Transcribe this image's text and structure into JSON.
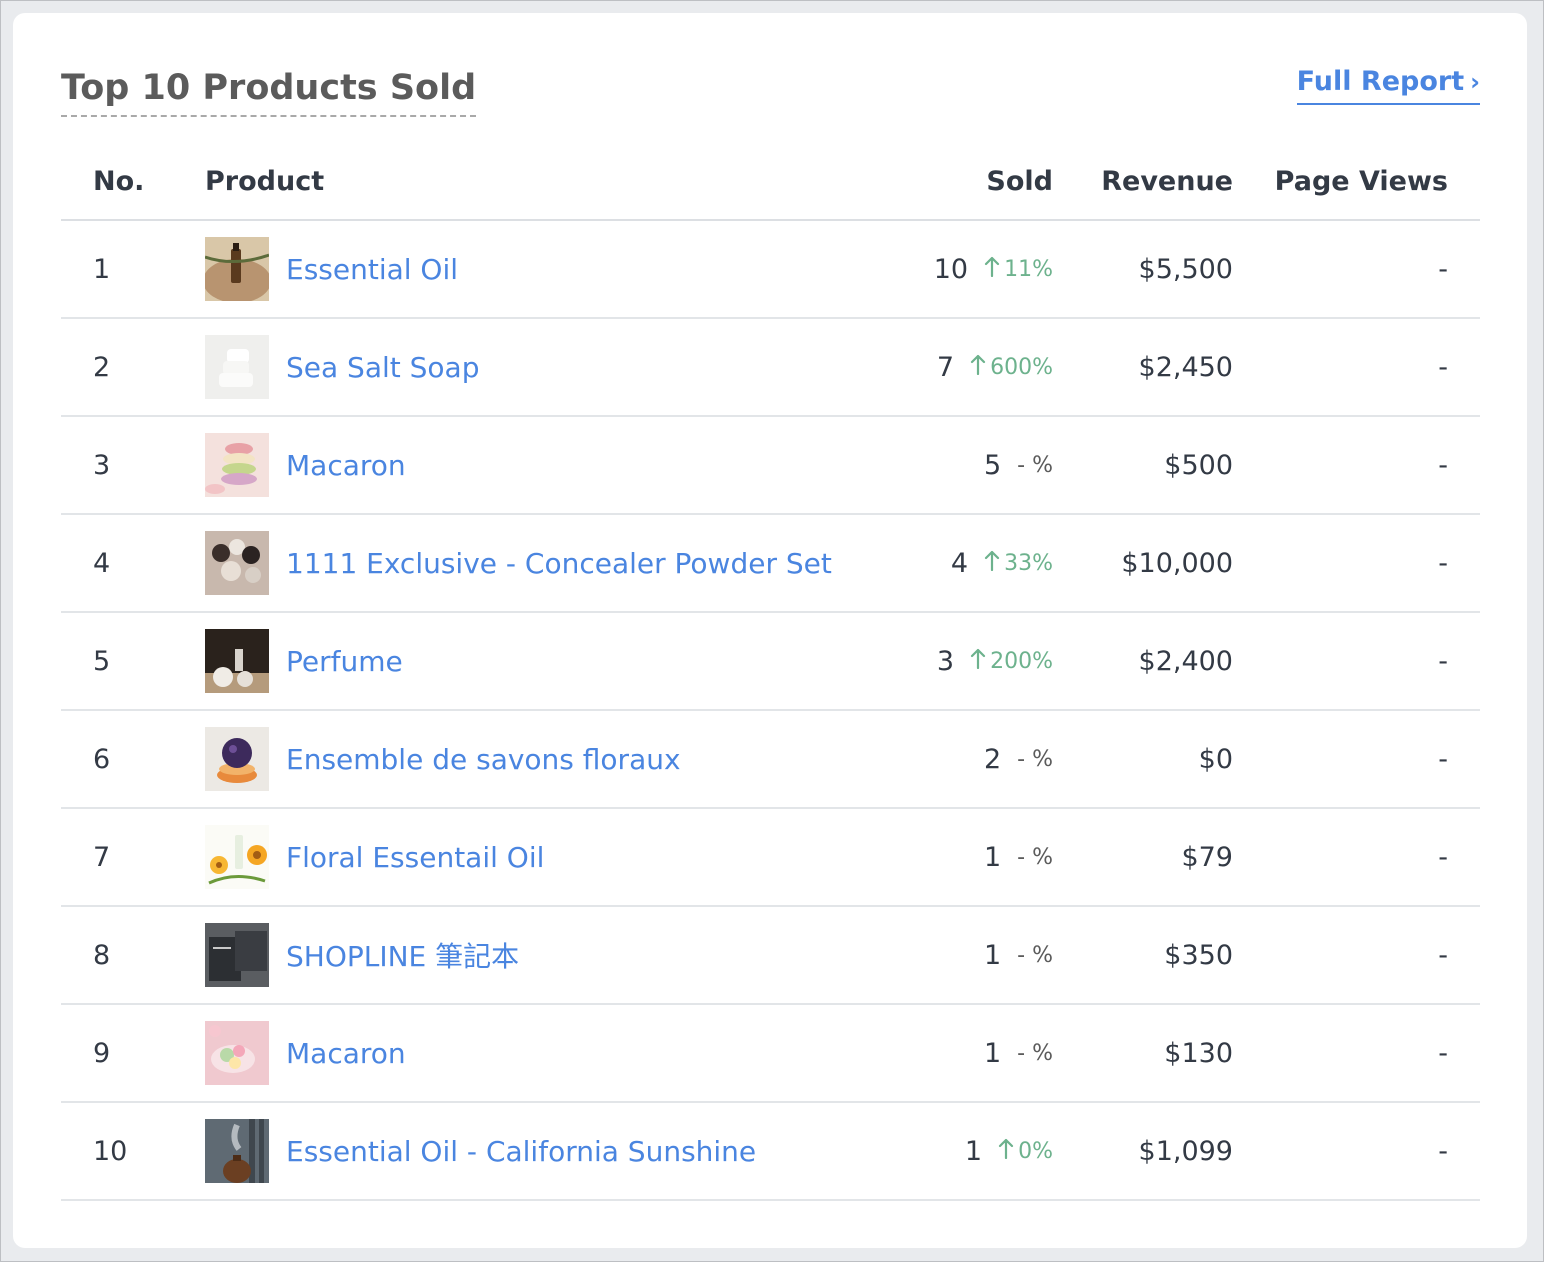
{
  "header": {
    "title": "Top 10 Products Sold",
    "full_report_label": "Full Report",
    "full_report_chevron": "›"
  },
  "table": {
    "columns": {
      "no": "No.",
      "product": "Product",
      "sold": "Sold",
      "revenue": "Revenue",
      "page_views": "Page Views"
    },
    "rows": [
      {
        "no": "1",
        "product": "Essential Oil",
        "sold": "10",
        "growth": "11%",
        "trend": "up",
        "revenue": "$5,500",
        "page_views": "-",
        "thumb": "essential-oil-thumbnail"
      },
      {
        "no": "2",
        "product": "Sea Salt Soap",
        "sold": "7",
        "growth": "600%",
        "trend": "up",
        "revenue": "$2,450",
        "page_views": "-",
        "thumb": "sea-salt-soap-thumbnail"
      },
      {
        "no": "3",
        "product": "Macaron",
        "sold": "5",
        "growth": "- %",
        "trend": "none",
        "revenue": "$500",
        "page_views": "-",
        "thumb": "macaron-thumbnail"
      },
      {
        "no": "4",
        "product": "1111 Exclusive - Concealer Powder Set",
        "sold": "4",
        "growth": "33%",
        "trend": "up",
        "revenue": "$10,000",
        "page_views": "-",
        "thumb": "concealer-thumbnail"
      },
      {
        "no": "5",
        "product": "Perfume",
        "sold": "3",
        "growth": "200%",
        "trend": "up",
        "revenue": "$2,400",
        "page_views": "-",
        "thumb": "perfume-thumbnail"
      },
      {
        "no": "6",
        "product": "Ensemble de savons floraux",
        "sold": "2",
        "growth": "- %",
        "trend": "none",
        "revenue": "$0",
        "page_views": "-",
        "thumb": "floral-soap-thumbnail"
      },
      {
        "no": "7",
        "product": "Floral Essentail Oil",
        "sold": "1",
        "growth": "- %",
        "trend": "none",
        "revenue": "$79",
        "page_views": "-",
        "thumb": "floral-oil-thumbnail"
      },
      {
        "no": "8",
        "product": "SHOPLINE 筆記本",
        "sold": "1",
        "growth": "- %",
        "trend": "none",
        "revenue": "$350",
        "page_views": "-",
        "thumb": "notebook-thumbnail"
      },
      {
        "no": "9",
        "product": "Macaron",
        "sold": "1",
        "growth": "- %",
        "trend": "none",
        "revenue": "$130",
        "page_views": "-",
        "thumb": "macaron-thumbnail-2"
      },
      {
        "no": "10",
        "product": "Essential Oil - California Sunshine",
        "sold": "1",
        "growth": "0%",
        "trend": "up",
        "revenue": "$1,099",
        "page_views": "-",
        "thumb": "diffuser-thumbnail"
      }
    ]
  },
  "colors": {
    "link": "#4a85e0",
    "growth_up": "#6db28d",
    "text": "#333a45",
    "title": "#5b5b5b"
  }
}
